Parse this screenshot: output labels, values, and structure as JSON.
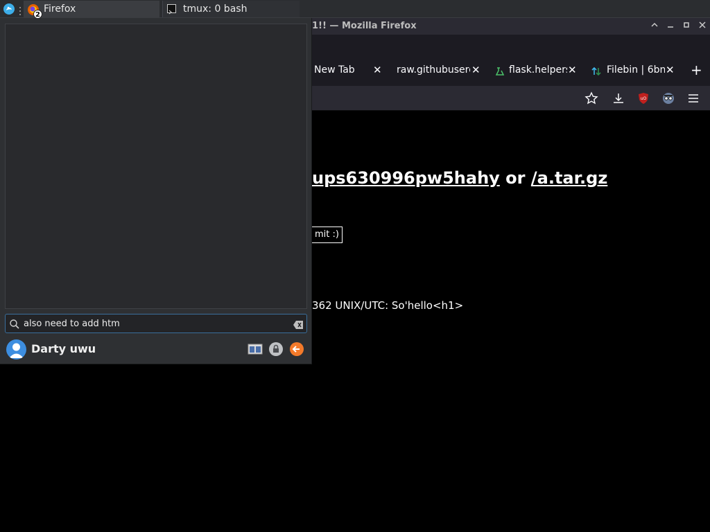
{
  "taskbar": {
    "firefox_label": "Firefox",
    "firefox_badge": "2",
    "tmux_label": "tmux: 0 bash"
  },
  "firefox": {
    "window_title": "1!! — Mozilla Firefox",
    "tabs": [
      {
        "label": "New Tab"
      },
      {
        "label": "raw.githubuserc"
      },
      {
        "label": "flask.helpers"
      },
      {
        "label": "Filebin | 6bn"
      }
    ],
    "new_tab": "+"
  },
  "page": {
    "link1": "ups630996pw5hahy",
    "or_text": "or",
    "link2": "/a.tar.gz",
    "button_text": "mit :)",
    "status_text": "362 UNIX/UTC: So'hello<h1>"
  },
  "launcher": {
    "search_value": "also need to add htm",
    "username": "Darty uwu"
  },
  "colors": {
    "accent": "#3d8ee0",
    "leave_button": "#f47a2a",
    "ublock_red": "#c0201e"
  }
}
